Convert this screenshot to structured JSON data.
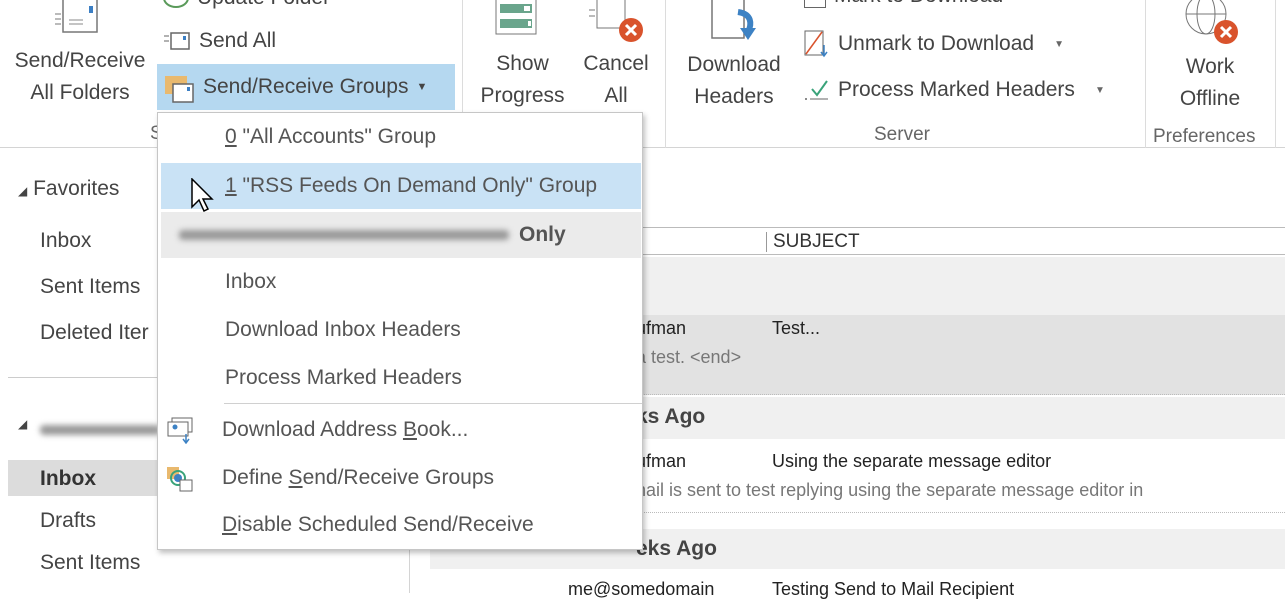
{
  "ribbon": {
    "send_receive_all": {
      "line1": "Send/Receive",
      "line2": "All Folders"
    },
    "update_folder": "Update Folder",
    "send_all": "Send All",
    "send_receive_groups": "Send/Receive Groups",
    "group_label_partial": "S",
    "show_progress": {
      "line1": "Show",
      "line2": "Progress"
    },
    "cancel_all": {
      "line1": "Cancel",
      "line2": "All"
    },
    "download_headers": {
      "line1": "Download",
      "line2": "Headers"
    },
    "mark_to_download": "Mark to Download",
    "unmark_to_download": "Unmark to Download",
    "process_marked_headers": "Process Marked Headers",
    "server_group": "Server",
    "work_offline": {
      "line1": "Work",
      "line2": "Offline"
    },
    "preferences_group": "Preferences",
    "highlight_color": "#b5d8f0"
  },
  "menu": {
    "items": [
      {
        "key": "0",
        "label": " \"All Accounts\" Group"
      },
      {
        "key": "1",
        "label": " \"RSS Feeds On Demand Only\" Group",
        "highlighted": true
      }
    ],
    "account_header_suffix": "Only",
    "account_items": [
      "Inbox",
      "Download Inbox Headers",
      "Process Marked Headers"
    ],
    "download_address_book": {
      "pre": "Download Address ",
      "key": "B",
      "post": "ook..."
    },
    "define_groups": {
      "pre": "Define ",
      "key": "S",
      "post": "end/Receive Groups"
    },
    "disable_scheduled": {
      "pre": "",
      "key": "D",
      "post": "isable Scheduled Send/Receive"
    }
  },
  "nav": {
    "favorites": "Favorites",
    "favorites_items": [
      "Inbox",
      "Sent Items",
      "Deleted Iter"
    ],
    "account_items": [
      "Inbox",
      "Drafts",
      "Sent Items"
    ]
  },
  "list": {
    "subject_header": "SUBJECT",
    "messages": [
      {
        "sender": "ufman",
        "subject": "Test...",
        "preview": "a test. <end>"
      },
      {
        "sender": "ufman",
        "subject": "Using the separate message editor",
        "preview": "nail is sent to test replying using the separate message editor in"
      },
      {
        "sender": "me@somedomain",
        "subject": "Testing Send to Mail Recipient"
      }
    ],
    "groups": [
      "ks Ago",
      "eks Ago"
    ]
  }
}
